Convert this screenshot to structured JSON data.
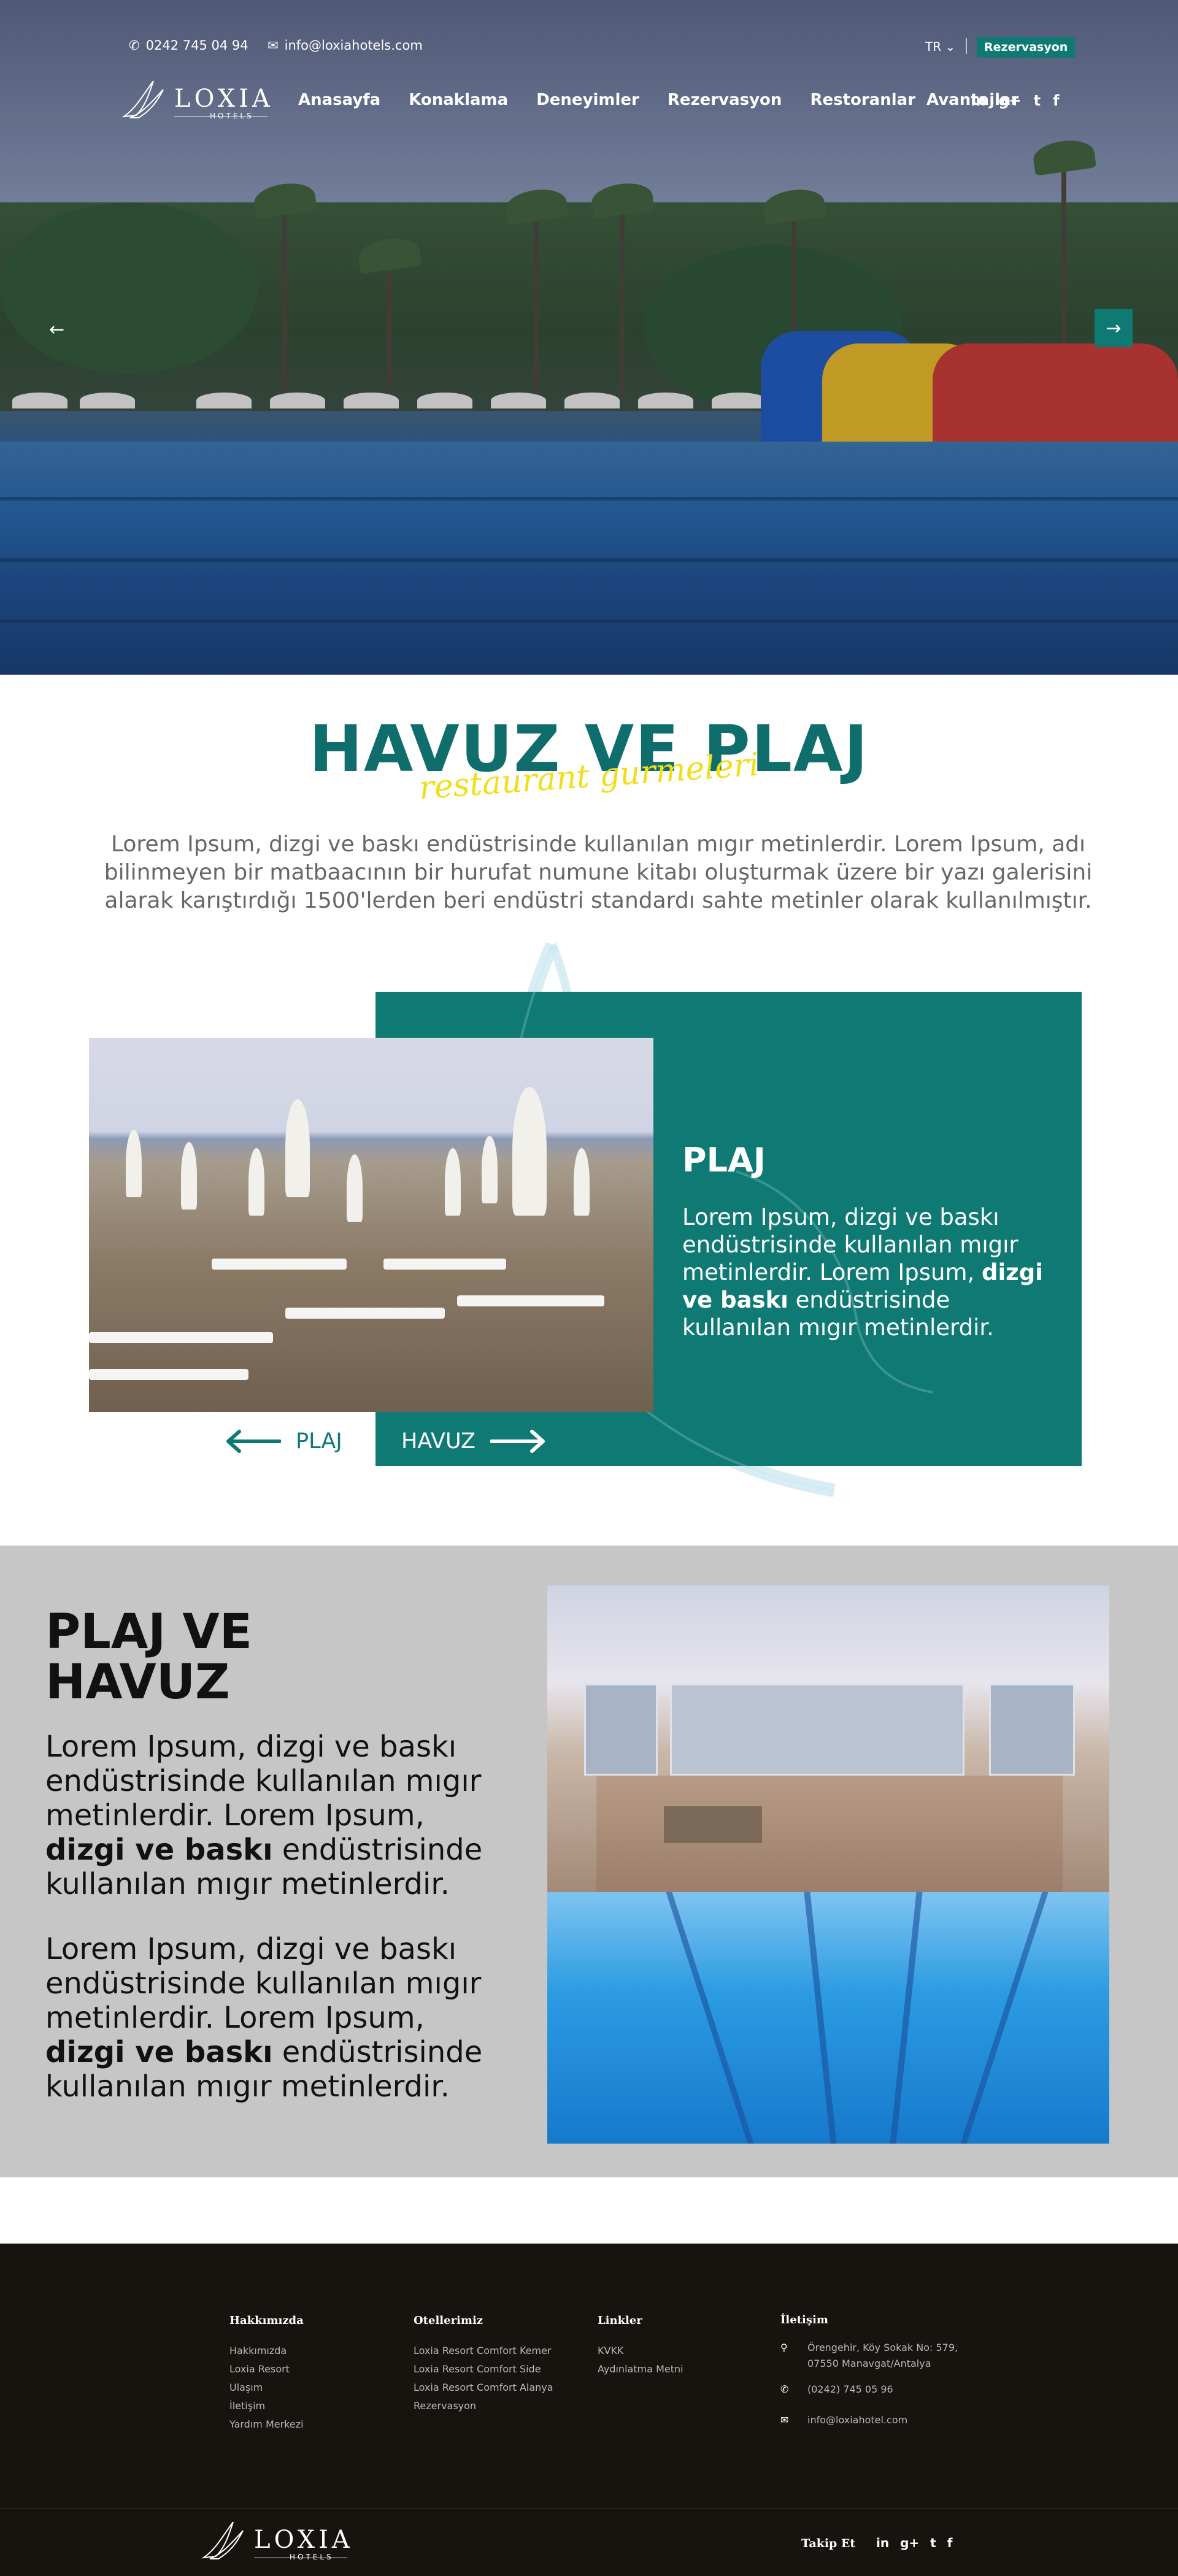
{
  "topbar": {
    "phone": "0242 745 04 94",
    "email": "info@loxiahotels.com",
    "language": "TR",
    "reservation_label": "Rezervasyon"
  },
  "logo": {
    "word": "LOXIA",
    "sub": "HOTELS"
  },
  "nav": {
    "items": [
      {
        "label": "Anasayfa"
      },
      {
        "label": "Konaklama"
      },
      {
        "label": "Deneyimler"
      },
      {
        "label": "Rezervasyon"
      },
      {
        "label": "Restoranlar"
      },
      {
        "label": "Avantajlar"
      }
    ]
  },
  "social": {
    "icons": [
      "linkedin-icon",
      "google-plus-icon",
      "twitter-icon",
      "facebook-icon"
    ],
    "labels": [
      "in",
      "g+",
      "t",
      "f"
    ]
  },
  "hero": {
    "prev": "←",
    "next": "→"
  },
  "section": {
    "title": "HAVUZ VE PLAJ",
    "script": "restaurant gurmeleri",
    "intro": "Lorem Ipsum, dizgi ve baskı endüstrisinde kullanılan mıgır metinlerdir. Lorem Ipsum, adı bilinmeyen bir matbaacının bir hurufat numune kitabı oluşturmak üzere bir yazı galerisini alarak karıştırdığı 1500'lerden beri endüstri standardı sahte metinler olarak kullanılmıştır."
  },
  "plaj_card": {
    "heading": "PLAJ",
    "text_a": "Lorem Ipsum, dizgi ve baskı endüstrisinde kullanılan mıgır metinlerdir. Lorem Ipsum, ",
    "text_bold": "dizgi ve baskı",
    "text_b": " endüstrisinde kullanılan mıgır metinlerdir.",
    "prev_label": "PLAJ",
    "next_label": "HAVUZ"
  },
  "grey_section": {
    "heading": "PLAJ VE HAVUZ",
    "p1_a": "Lorem Ipsum, dizgi ve baskı endüstrisinde kullanılan mıgır metinlerdir. Lorem Ipsum, ",
    "p1_bold": "dizgi ve baskı",
    "p1_b": " endüstrisinde kullanılan mıgır metinlerdir.",
    "p2_a": "Lorem Ipsum, dizgi ve baskı endüstrisinde kullanılan mıgır metinlerdir. Lorem Ipsum, ",
    "p2_bold": "dizgi ve baskı",
    "p2_b": " endüstrisinde kullanılan mıgır metinlerdir."
  },
  "footer": {
    "about": {
      "title": "Hakkımızda",
      "links": [
        "Hakkımızda",
        "Loxia Resort",
        "Ulaşım",
        "İletişim",
        "Yardım Merkezi"
      ]
    },
    "hotels": {
      "title": "Otellerimiz",
      "links": [
        "Loxia Resort Comfort Kemer",
        "Loxia Resort Comfort Side",
        "Loxia Resort Comfort Alanya",
        "Rezervasyon"
      ]
    },
    "links": {
      "title": "Linkler",
      "links": [
        "KVKK",
        "Aydınlatma Metni"
      ]
    },
    "contact": {
      "title": "İletişim",
      "address_1": "Örengehir, Köy Sokak No: 579,",
      "address_2": "07550 Manavgat/Antalya",
      "phone": "(0242) 745 05 96",
      "email": "info@loxiahotel.com"
    },
    "follow_label": "Takip Et"
  },
  "colors": {
    "teal": "#0f7a74",
    "title_teal": "#0f6e6c",
    "yellow": "#f0de1a",
    "footer_bg": "#17130f",
    "grey_bg": "#c6c6c6"
  }
}
